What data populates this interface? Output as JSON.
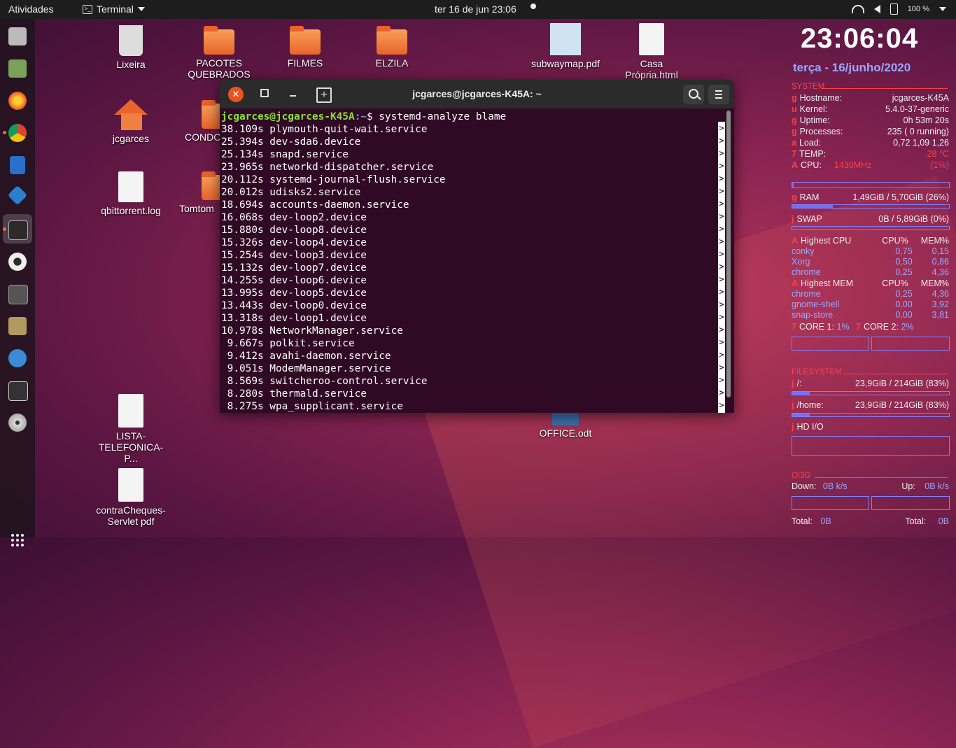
{
  "topbar": {
    "activities": "Atividades",
    "app_menu": "Terminal",
    "datetime": "ter 16 de jun  23:06",
    "battery": "100 %"
  },
  "desktop": [
    {
      "label": "Lixeira",
      "icon": "trash-icon"
    },
    {
      "label": "PACOTES QUEBRADOS",
      "icon": "folder-icon"
    },
    {
      "label": "FILMES",
      "icon": "folder-icon"
    },
    {
      "label": "ELZILA",
      "icon": "folder-icon"
    },
    {
      "label": "subwaymap.pdf",
      "icon": "pdf-icon"
    },
    {
      "label": "Casa Própria.html",
      "icon": "html-file-icon"
    },
    {
      "label": "jcgarces",
      "icon": "home-folder-icon"
    },
    {
      "label": "CONDO",
      "icon": "folder-icon"
    },
    {
      "label": "qbittorrent.log",
      "icon": "text-file-icon"
    },
    {
      "label": "Tomtom",
      "icon": "folder-icon"
    },
    {
      "label": "LISTA-TELEFONICA-P...",
      "icon": "document-icon"
    },
    {
      "label": "contraCheques-Servlet pdf",
      "icon": "document-icon"
    },
    {
      "label": "OFFICE.odt",
      "icon": "odt-icon"
    }
  ],
  "terminal": {
    "title": "jcgarces@jcgarces-K45A: ~",
    "prompt_user": "jcgarces@jcgarces-K45A",
    "prompt_path": ":~",
    "command": "$ systemd-analyze blame",
    "lines": [
      "38.109s plymouth-quit-wait.service",
      "25.394s dev-sda6.device",
      "25.134s snapd.service",
      "23.965s networkd-dispatcher.service",
      "20.112s systemd-journal-flush.service",
      "20.012s udisks2.service",
      "18.694s accounts-daemon.service",
      "16.068s dev-loop2.device",
      "15.880s dev-loop8.device",
      "15.326s dev-loop4.device",
      "15.254s dev-loop3.device",
      "15.132s dev-loop7.device",
      "14.255s dev-loop6.device",
      "13.995s dev-loop5.device",
      "13.443s dev-loop0.device",
      "13.318s dev-loop1.device",
      "10.978s NetworkManager.service",
      " 9.667s polkit.service",
      " 9.412s avahi-daemon.service",
      " 9.051s ModemManager.service",
      " 8.569s switcheroo-control.service",
      " 8.280s thermald.service",
      " 8.275s wpa_supplicant.service"
    ]
  },
  "conky": {
    "time": "23:06:04",
    "date": "terça - 16/junho/2020",
    "system_title": "SYSTEM",
    "hostname_label": "Hostname:",
    "hostname": "jcgarces-K45A",
    "kernel_label": "Kernel:",
    "kernel": "5.4.0-37-generic",
    "uptime_label": "Uptime:",
    "uptime": "0h 53m 20s",
    "processes_label": "Processes:",
    "processes": "235 (    0 running)",
    "load_label": "Load:",
    "load": "0,72 1,09 1,26",
    "temp_label": "TEMP:",
    "temp": "28 °C",
    "cpu_label": "CPU:",
    "cpu_freq": "1430MHz",
    "cpu_pct": "(1%)",
    "ram_label": "RAM",
    "ram": "1,49GiB / 5,70GiB (26%)",
    "ram_fill": 0.26,
    "swap_label": "SWAP",
    "swap": "0B   / 5,89GiB (0%)",
    "swap_fill": 0.0,
    "cpu_fill": 0.01,
    "highest_cpu": "Highest CPU",
    "col_cpu": "CPU%",
    "col_mem": "MEM%",
    "cpu_procs": [
      {
        "name": "conky",
        "cpu": "0,75",
        "mem": "0,15"
      },
      {
        "name": "Xorg",
        "cpu": "0,50",
        "mem": "0,86"
      },
      {
        "name": "chrome",
        "cpu": "0,25",
        "mem": "4,36"
      }
    ],
    "highest_mem": "Highest MEM",
    "mem_procs": [
      {
        "name": "chrome",
        "cpu": "0,25",
        "mem": "4,36"
      },
      {
        "name": "gnome-shell",
        "cpu": "0,00",
        "mem": "3,92"
      },
      {
        "name": "snap-store",
        "cpu": "0,00",
        "mem": "3,81"
      }
    ],
    "core1_label": "CORE 1:",
    "core1": "1%",
    "core2_label": "CORE 2:",
    "core2": "2%",
    "filesystem_title": "FILESYSTEM",
    "root_label": "/:",
    "root": "23,9GiB /  214GiB (83%)",
    "root_fill": 0.11,
    "home_label": "/home:",
    "home": "23,9GiB /  214GiB (83%)",
    "home_fill": 0.11,
    "hd_label": "HD  I/O",
    "net_title": "OI3G",
    "down_label": "Down:",
    "down": "0B   k/s",
    "up_label": "Up:",
    "up": "0B   k/s",
    "total_down_label": "Total:",
    "total_down": "0B",
    "total_up_label": "Total:",
    "total_up": "0B",
    "glyph_g": "g",
    "glyph_u": "u",
    "glyph_a": "a",
    "glyph_7": "7",
    "glyph_A": "A",
    "glyph_j": "j"
  },
  "colors": {
    "accent": "#e95420",
    "terminal_bg": "#300a24",
    "conky_red": "#ff4040",
    "conky_blue": "#9aa7ff"
  }
}
